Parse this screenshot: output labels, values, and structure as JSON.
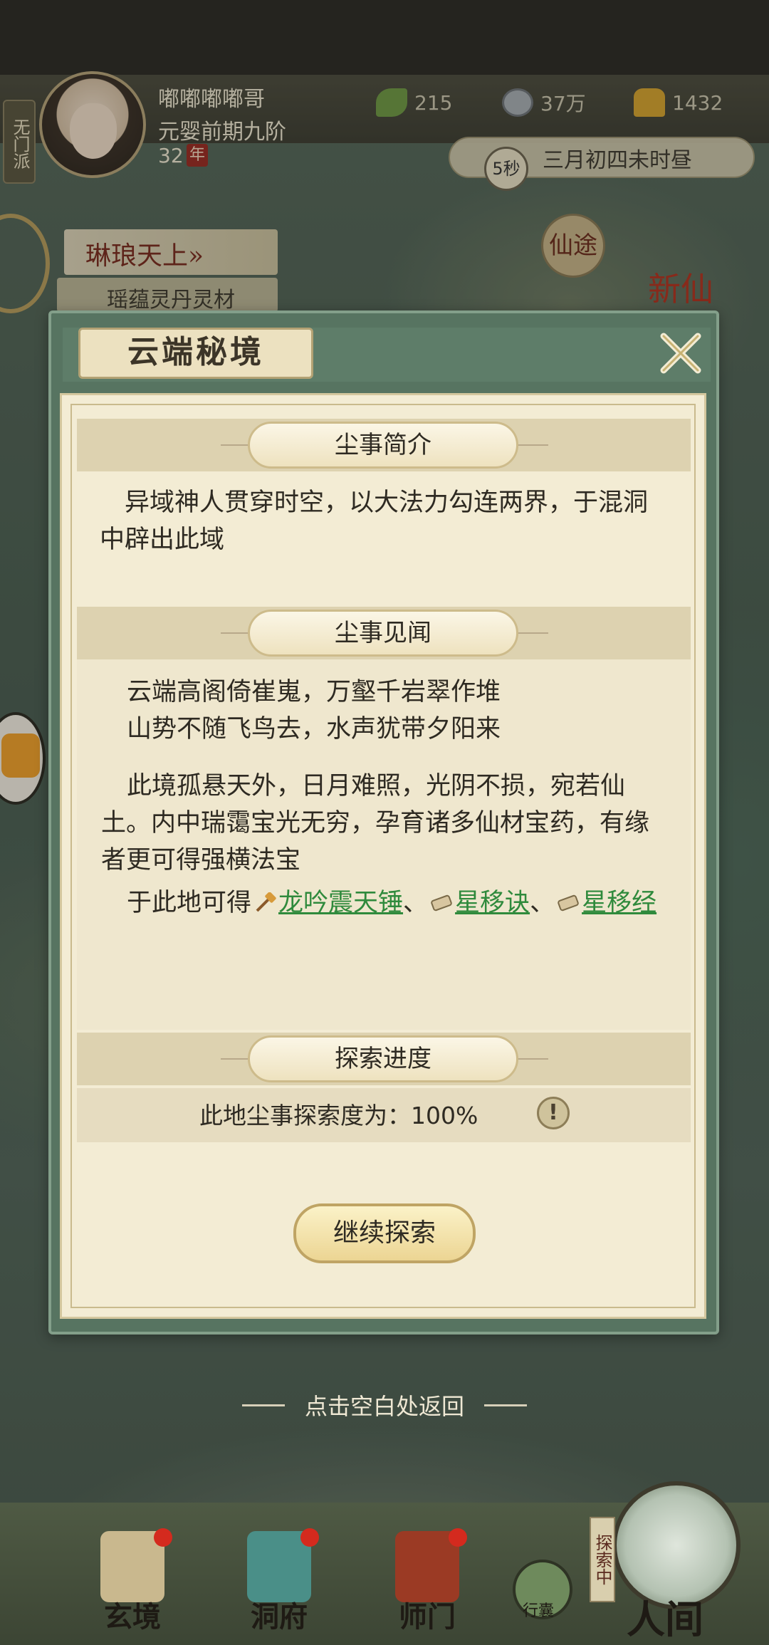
{
  "colors": {
    "modal_frame": "#577461",
    "panel_bg": "#f3ecd4",
    "link": "#2f8a3c",
    "badge_red": "#d42a1e"
  },
  "hud": {
    "sect": "无门派",
    "player_name": "嘟嘟嘟嘟哥",
    "realm": "元婴前期九阶",
    "age": "32",
    "age_unit": "年",
    "resources": [
      {
        "icon": "leaf-icon",
        "value": "215"
      },
      {
        "icon": "coin-icon",
        "value": "37万"
      },
      {
        "icon": "gold-ingot-icon",
        "value": "1432"
      }
    ],
    "timer_seconds": "5秒",
    "game_time": "三月初四未时昼"
  },
  "map": {
    "location": "琳琅天上",
    "location_arrow": "»",
    "location_sub": "瑶蕴灵丹灵材",
    "seal_1": "仙途",
    "seal_2": "新仙"
  },
  "modal": {
    "title": "云端秘境",
    "sections": {
      "intro": {
        "title": "尘事简介",
        "text": "异域神人贯穿时空，以大法力勾连两界，于混洞中辟出此域"
      },
      "lore": {
        "title": "尘事见闻",
        "poem_line_1": "云端高阁倚崔嵬，万壑千岩翠作堆",
        "poem_line_2": "山势不随飞鸟去，水声犹带夕阳来",
        "desc": "此境孤悬天外，日月难照，光阴不损，宛若仙土。内中瑞霭宝光无穷，孕育诸多仙材宝药，有缘者更可得强横法宝",
        "rewards_prefix": "于此地可得",
        "rewards": [
          {
            "name": "龙吟震天锤",
            "icon": "hammer-icon"
          },
          {
            "name": "星移诀",
            "icon": "scroll-icon"
          },
          {
            "name": "星移经",
            "icon": "scroll-icon"
          }
        ],
        "separator": "、"
      },
      "progress": {
        "title": "探索进度",
        "text": "此地尘事探索度为：100%",
        "percent": 100
      }
    },
    "continue_button": "继续探索",
    "return_hint": "点击空白处返回"
  },
  "bottom_nav": {
    "items": [
      {
        "label": "玄境"
      },
      {
        "label": "洞府"
      },
      {
        "label": "师门"
      }
    ],
    "bag_label": "行囊",
    "explore_tag": "探索中",
    "world_label": "人间"
  }
}
